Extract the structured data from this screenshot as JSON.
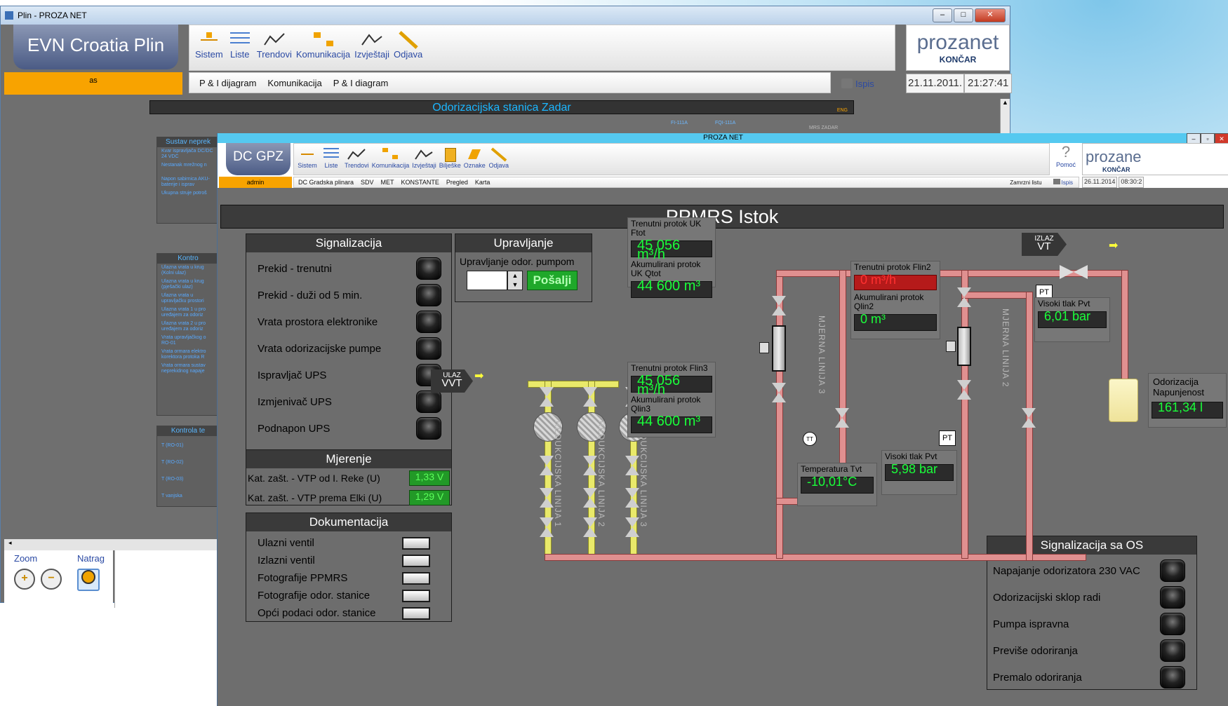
{
  "back_window": {
    "title": "Plin - PROZA NET",
    "app_button": "EVN Croatia Plin",
    "user": "as",
    "toolbar": [
      "Sistem",
      "Liste",
      "Trendovi",
      "Komunikacija",
      "Izvještaji",
      "Odjava"
    ],
    "subnav": [
      "P & I dijagram",
      "Komunikacija",
      "P & I diagram"
    ],
    "print": "Ispis",
    "brand": "prozanet",
    "brand_sub": "KONČAR",
    "date": "21.11.2011.",
    "time": "21:27:41",
    "station_title": "Odorizacijska stanica Zadar",
    "station_tag": "ENG",
    "mini_labels": [
      "FI-111A",
      "FQI-111A",
      "MRS ZADAR"
    ],
    "panels": [
      {
        "title": "Sustav neprek",
        "items": [
          "Kvar ispravljača DC/DC 24 VDC",
          "Nestanak mrežnog n",
          "Napon sabirnica AKU-baterije i isprav",
          "Ukupna struje potroš"
        ]
      },
      {
        "title": "Kontro",
        "items": [
          "Ulazna vrata u krug (Kolni ulaz)",
          "Ulazna vrata u krug (pješački ulaz)",
          "Ulazna vrata u upravljačku prostori",
          "Ulazna vrata 1 u pro uređajem za odoriz",
          "Ulazna vrata 2 u pro uređajem za odoriz",
          "Vrata upravljačkog o RO-01",
          "Vrata ormara elektro korektora protoka R",
          "Vrata ormara sustav neprekidnog napaje"
        ]
      },
      {
        "title": "Kontrola te",
        "items": [
          "T (RO-01)",
          "T (RO-02)",
          "T (RO-03)",
          "T vanjska"
        ]
      }
    ],
    "zoom_label": "Zoom",
    "back_label": "Natrag"
  },
  "front_window": {
    "title": "PROZA NET",
    "app_button": "DC GPZ",
    "user": "admin",
    "toolbar": [
      "Sistem",
      "Liste",
      "Trendovi",
      "Komunikacija",
      "Izvještaji",
      "Bilješke",
      "Oznake",
      "Odjava"
    ],
    "help": "Pomoć",
    "subnav": [
      "DC Gradska plinara",
      "SDV",
      "MET",
      "KONSTANTE",
      "Pregled",
      "Karta"
    ],
    "freeze": "Zamrzni listu",
    "print": "Ispis",
    "brand": "prozane",
    "brand_sub": "KONČAR",
    "date": "26.11.2014",
    "time": "08:30:2",
    "page_title": "PPMRS Istok",
    "signalizacija": {
      "title": "Signalizacija",
      "items": [
        "Prekid - trenutni",
        "Prekid - duži od 5 min.",
        "Vrata prostora elektronike",
        "Vrata odorizacijske pumpe",
        "Ispravljač UPS",
        "Izmjenivač UPS",
        "Podnapon UPS"
      ]
    },
    "upravljanje": {
      "title": "Upravljanje",
      "label": "Upravljanje odor. pumpom",
      "send": "Pošalji"
    },
    "mjerenje": {
      "title": "Mjerenje",
      "rows": [
        {
          "label": "Kat. zašt. - VTP od I. Reke (U)",
          "value": "1,33 V"
        },
        {
          "label": "Kat. zašt. - VTP prema Elki (U)",
          "value": "1,29 V"
        }
      ]
    },
    "dokumentacija": {
      "title": "Dokumentacija",
      "items": [
        "Ulazni ventil",
        "Izlazni ventil",
        "Fotografije PPMRS",
        "Fotografije odor. stanice",
        "Opći podaci odor. stanice"
      ]
    },
    "signalizacija_os": {
      "title": "Signalizacija sa OS",
      "items": [
        "Napajanje odorizatora 230 VAC",
        "Odorizacijski sklop radi",
        "Pumpa ispravna",
        "Previše odoriranja",
        "Premalo odoriranja"
      ]
    },
    "measurements": {
      "ftot_label": "Trenutni protok UK Ftot",
      "ftot_value": "45 056 m³/h",
      "qtot_label": "Akumulirani protok UK Qtot",
      "qtot_value": "44 600 m³",
      "flin2_label": "Trenutni protok Flin2",
      "flin2_value": "0 m³/h",
      "qlin2_label": "Akumulirani protok Qlin2",
      "qlin2_value": "0 m³",
      "flin3_label": "Trenutni protok Flin3",
      "flin3_value": "45 056 m³/h",
      "qlin3_label": "Akumulirani protok Qlin3",
      "qlin3_value": "44 600 m³",
      "temp_label": "Temperatura Tvt",
      "temp_value": "-10,01°C",
      "pvt_label": "Visoki tlak Pvt",
      "pvt_value": "5,98 bar",
      "pvt2_label": "Visoki tlak Pvt",
      "pvt2_value": "6,01 bar",
      "odor_label": "Odorizacija Napunjenost",
      "odor_value": "161,34 l"
    },
    "diagram": {
      "ulaz": "ULAZ",
      "ulaz_code": "VVT",
      "izlaz": "IZLAZ",
      "izlaz_code": "VT",
      "red1": "REDUKCIJSKA LINIJA 1",
      "red2": "REDUKCIJSKA LINIJA 2",
      "red3": "REDUKCIJSKA LINIJA 3",
      "mj3": "MJERNA LINIJA 3",
      "mj2": "MJERNA LINIJA 2",
      "pt": "PT",
      "tt": "TT"
    },
    "colors": {
      "orange": "#f8a300",
      "green": "#1aff3a",
      "red_alarm": "#ff2b2b"
    }
  }
}
